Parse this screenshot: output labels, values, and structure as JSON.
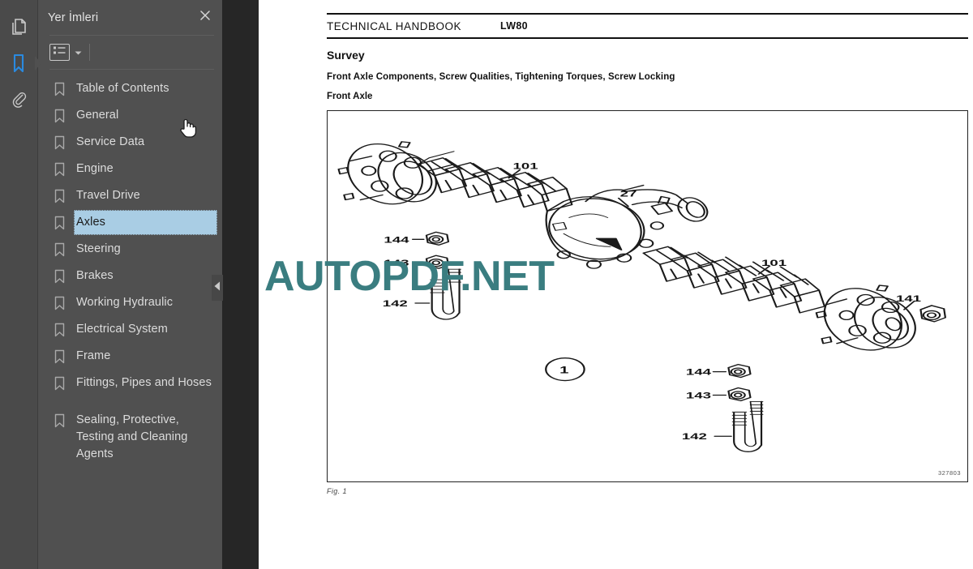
{
  "app": {
    "rail": [
      {
        "name": "thumbnails",
        "icon": "pages-icon",
        "active": false
      },
      {
        "name": "bookmarks",
        "icon": "bookmark-icon",
        "active": true
      },
      {
        "name": "attachments",
        "icon": "paperclip-icon",
        "active": false
      }
    ]
  },
  "sidebar": {
    "title": "Yer İmleri",
    "close_label": "✕",
    "toolbar": {
      "list_icon": "list-view-icon",
      "caret_icon": "chevron-down-icon"
    },
    "collapse_icon": "collapse-left-icon",
    "items": [
      {
        "label": "Table of Contents",
        "selected": false,
        "gap": false
      },
      {
        "label": "General",
        "selected": false,
        "gap": false
      },
      {
        "label": "Service Data",
        "selected": false,
        "gap": false
      },
      {
        "label": "Engine",
        "selected": false,
        "gap": false
      },
      {
        "label": "Travel Drive",
        "selected": false,
        "gap": false
      },
      {
        "label": "Axles",
        "selected": true,
        "gap": false
      },
      {
        "label": "Steering",
        "selected": false,
        "gap": false
      },
      {
        "label": "Brakes",
        "selected": false,
        "gap": false
      },
      {
        "label": "Working Hydraulic",
        "selected": false,
        "gap": false
      },
      {
        "label": "Electrical System",
        "selected": false,
        "gap": false
      },
      {
        "label": "Frame",
        "selected": false,
        "gap": false
      },
      {
        "label": "Fittings, Pipes and Hoses",
        "selected": false,
        "gap": false
      },
      {
        "label": "Sealing, Protective, Testing and Cleaning Agents",
        "selected": false,
        "gap": true
      }
    ]
  },
  "document": {
    "header_left": "TECHNICAL HANDBOOK",
    "header_right": "LW80",
    "title": "Survey",
    "subtitle": "Front Axle Components, Screw Qualities, Tightening Torques, Screw Locking",
    "section": "Front Axle",
    "figure_id": "327803",
    "figure_caption": "Fig. 1",
    "callouts": {
      "c101_left": "101",
      "c101_right": "101",
      "c27": "27",
      "c144_top": "144",
      "c143_top": "143",
      "c142_top": "142",
      "c144_bottom": "144",
      "c143_bottom": "143",
      "c142_bottom": "142",
      "c141": "141",
      "circle1": "1"
    }
  },
  "watermark": {
    "text": "AUTOPDF.NET",
    "color": "#3a7d80"
  },
  "colors": {
    "rail_bg": "#4a4a4a",
    "panel_bg": "#505050",
    "viewer_bg": "#262626",
    "selection": "#a9cde4",
    "accent": "#2a8ae0",
    "page_bg": "#ffffff"
  },
  "cursor": {
    "icon": "pointing-hand-cursor"
  }
}
